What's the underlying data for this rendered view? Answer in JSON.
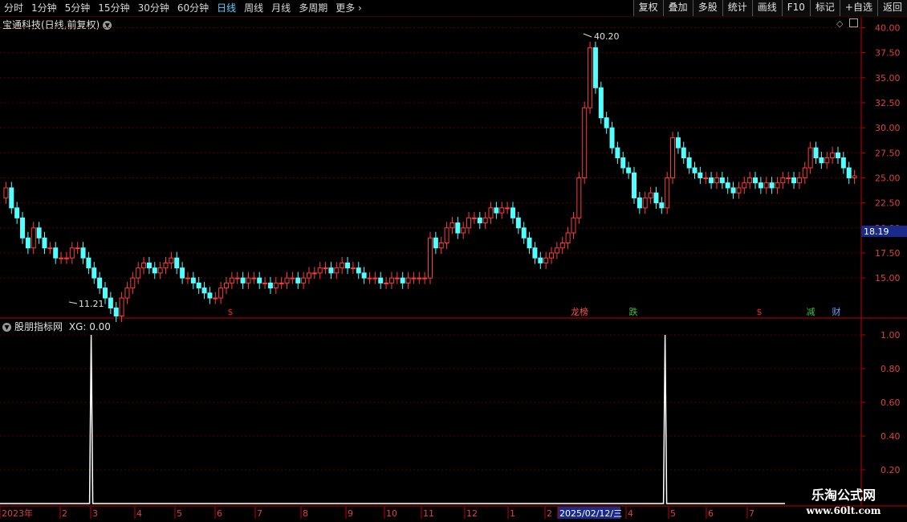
{
  "toolbar": {
    "periods": [
      {
        "label": "分时",
        "active": false
      },
      {
        "label": "1分钟",
        "active": false
      },
      {
        "label": "5分钟",
        "active": false
      },
      {
        "label": "15分钟",
        "active": false
      },
      {
        "label": "30分钟",
        "active": false
      },
      {
        "label": "60分钟",
        "active": false
      },
      {
        "label": "日线",
        "active": true
      },
      {
        "label": "周线",
        "active": false
      },
      {
        "label": "月线",
        "active": false
      },
      {
        "label": "多周期",
        "active": false
      },
      {
        "label": "更多",
        "active": false
      }
    ],
    "tools": [
      "复权",
      "叠加",
      "多股",
      "统计",
      "画线",
      "F10",
      "标记",
      "+自选",
      "返回"
    ]
  },
  "main_chart": {
    "title": "宝通科技(日线,前复权)",
    "high_label": "40.20",
    "low_label": "11.21",
    "current_price": "18.19",
    "y_ticks": [
      "40.00",
      "37.50",
      "35.00",
      "32.50",
      "30.00",
      "27.50",
      "25.00",
      "22.50",
      "20.00",
      "17.50",
      "15.00"
    ],
    "event_markers": [
      {
        "label": "$",
        "color": "#e03030"
      },
      {
        "label": "龙榜",
        "color": "#ff5050"
      },
      {
        "label": "跌",
        "color": "#40c040"
      },
      {
        "label": "$",
        "color": "#e03030"
      },
      {
        "label": "减",
        "color": "#40c040"
      },
      {
        "label": "财",
        "color": "#6aa0ff"
      }
    ]
  },
  "indicator": {
    "title": "股朋指标网",
    "value_label": "XG: 0.00",
    "y_ticks": [
      "1.00",
      "0.80",
      "0.60",
      "0.40",
      "0.20"
    ]
  },
  "x_axis": {
    "labels": [
      "2023年",
      "2",
      "3",
      "4",
      "5",
      "6",
      "7",
      "8",
      "9",
      "10",
      "11",
      "12",
      "1",
      "2",
      "2025/02/12/三",
      "4",
      "5",
      "6",
      "7"
    ]
  },
  "watermark": {
    "line1": "乐淘公式网",
    "line2": "www.60lt.com"
  },
  "chart_data": {
    "type": "candlestick",
    "ylim": [
      11,
      41
    ],
    "close": [
      24,
      22,
      21,
      19,
      18,
      20,
      19,
      18,
      18,
      17,
      17,
      17,
      18,
      18,
      17,
      16,
      15,
      14,
      13,
      12,
      11.2,
      13,
      14,
      15,
      16,
      16.5,
      16,
      15.5,
      16,
      16.5,
      17,
      16,
      15,
      15,
      14.5,
      14,
      13.5,
      13,
      13,
      14,
      14.5,
      15,
      15,
      14.5,
      15,
      15,
      14.5,
      14.5,
      14,
      14.5,
      14.5,
      15,
      15,
      14.5,
      15,
      15.5,
      15.5,
      16,
      16,
      15.5,
      16,
      16.5,
      16,
      16,
      15.5,
      15,
      15,
      15,
      14.5,
      14.5,
      15,
      15,
      14.5,
      15,
      15,
      15,
      15,
      19,
      18,
      18.5,
      20,
      20.5,
      19.5,
      20,
      21,
      21,
      20.5,
      21,
      22,
      21.5,
      22,
      22,
      21,
      20,
      19,
      18,
      17,
      16.5,
      17,
      17.5,
      18,
      18.5,
      19.5,
      21,
      25,
      32,
      38,
      34,
      31,
      30,
      28,
      27,
      26,
      25.5,
      23,
      22,
      23,
      23.5,
      22.5,
      22,
      25,
      29,
      28,
      27,
      26,
      25.5,
      25,
      25,
      24.5,
      25,
      24.5,
      24,
      23.5,
      24,
      24.5,
      25,
      24.5,
      24,
      24.5,
      24,
      24.5,
      25,
      25,
      24.5,
      25,
      26,
      28,
      27,
      26.5,
      27,
      27.5,
      27,
      26,
      25,
      25.2
    ],
    "open": [
      23,
      24,
      22,
      21,
      19,
      18,
      20,
      19,
      18,
      18,
      17,
      17,
      17,
      18,
      18,
      17,
      16,
      15,
      14,
      13,
      12,
      11.2,
      13,
      14,
      15,
      16,
      16.5,
      16,
      15.5,
      16,
      16.5,
      17,
      16,
      15,
      15,
      14.5,
      14,
      13.5,
      13,
      13,
      14,
      14.5,
      15,
      15,
      14.5,
      15,
      15,
      14.5,
      14.5,
      14,
      14.5,
      14.5,
      15,
      15,
      14.5,
      15,
      15.5,
      15.5,
      16,
      16,
      15.5,
      16,
      16.5,
      16,
      16,
      15.5,
      15,
      15,
      15,
      14.5,
      14.5,
      15,
      15,
      14.5,
      15,
      15,
      15,
      15,
      19,
      18,
      18.5,
      20,
      20.5,
      19.5,
      20,
      21,
      21,
      20.5,
      21,
      22,
      21.5,
      22,
      22,
      21,
      20,
      19,
      18,
      17,
      16.5,
      17,
      17.5,
      18,
      18.5,
      19.5,
      21,
      25,
      32,
      38,
      34,
      31,
      30,
      28,
      27,
      26,
      25.5,
      23,
      22,
      23,
      23.5,
      22.5,
      22,
      25,
      29,
      28,
      27,
      26,
      25.5,
      25,
      25,
      24.5,
      25,
      24.5,
      24,
      23.5,
      24,
      24.5,
      25,
      24.5,
      24,
      24.5,
      24,
      24.5,
      25,
      25,
      24.5,
      25,
      26,
      28,
      27,
      26.5,
      27,
      27.5,
      27,
      26,
      25
    ],
    "xg_signals": [
      {
        "bar_fraction": 0.103,
        "value": 1.0
      },
      {
        "bar_fraction": 0.775,
        "value": 1.0
      }
    ]
  }
}
